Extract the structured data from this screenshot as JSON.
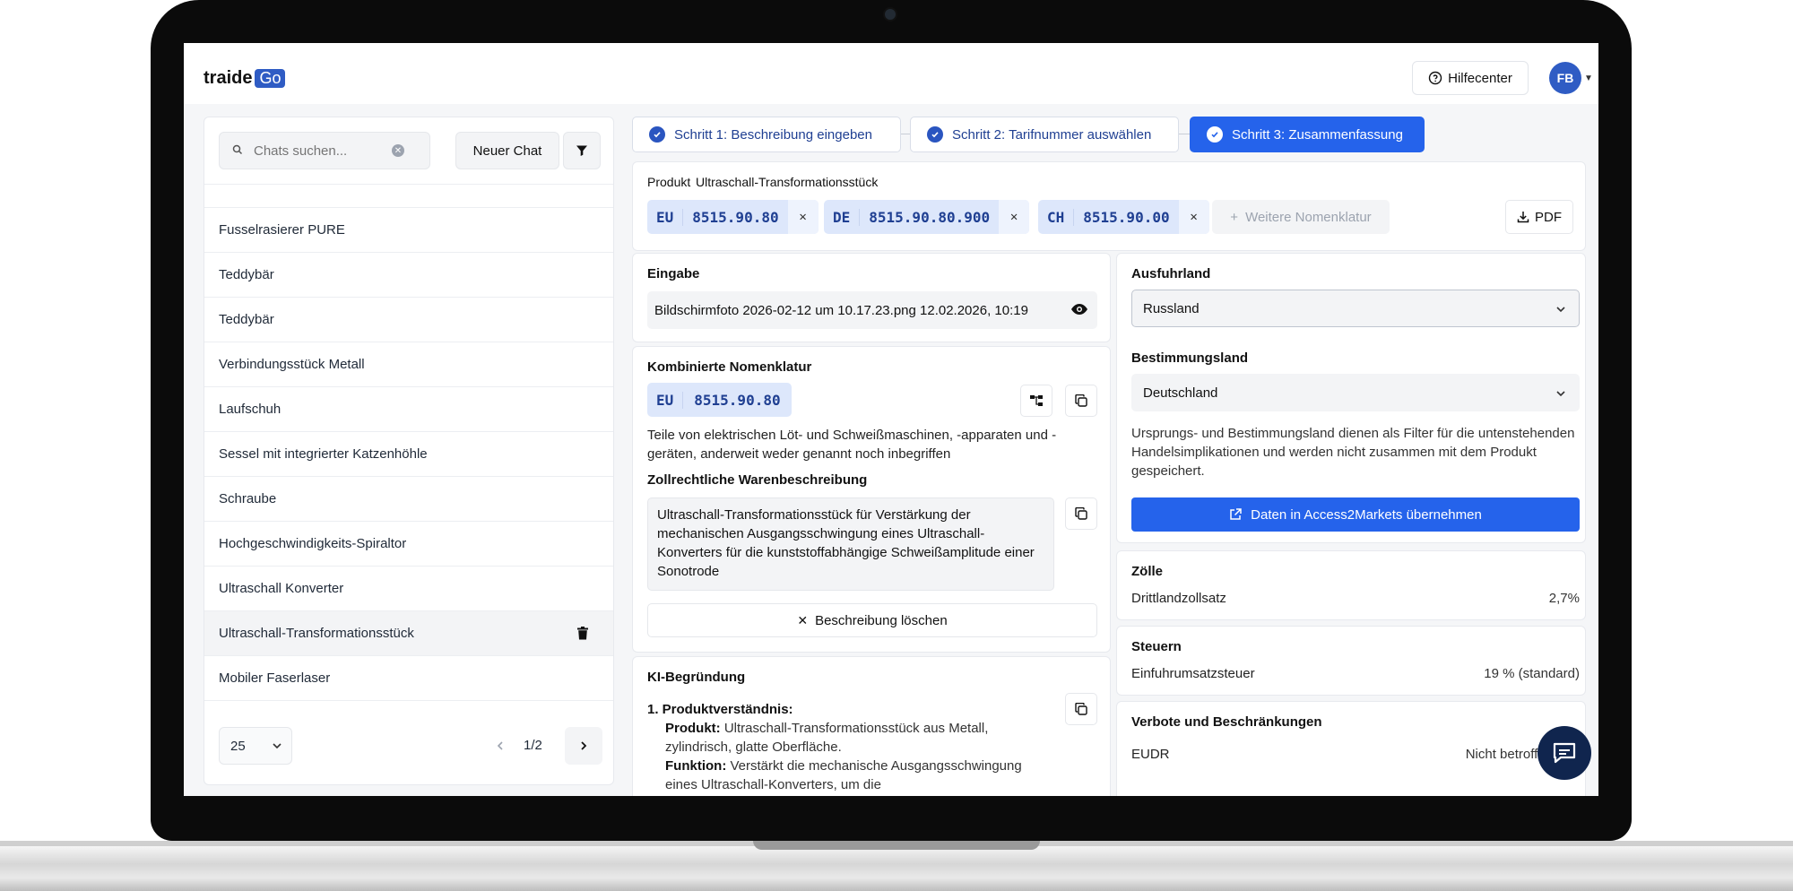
{
  "app": {
    "logo_text": "traide",
    "logo_badge": "Go"
  },
  "header": {
    "help_label": "Hilfecenter",
    "avatar_initials": "FB"
  },
  "sidebar": {
    "search_placeholder": "Chats suchen...",
    "new_chat_label": "Neuer Chat",
    "chats": [
      "Fusselrasierer PURE",
      "Teddybär",
      "Teddybär",
      "Verbindungsstück Metall",
      "Laufschuh",
      "Sessel mit integrierter Katzenhöhle",
      "Schraube",
      "Hochgeschwindigkeits-Spiraltor",
      "Ultraschall Konverter",
      "Ultraschall-Transformationsstück",
      "Mobiler Faserlaser"
    ],
    "page_size": "25",
    "page_indicator": "1/2"
  },
  "steps": [
    {
      "label": "Schritt 1: Beschreibung eingeben"
    },
    {
      "label": "Schritt 2: Tarifnummer auswählen"
    },
    {
      "label": "Schritt 3: Zusammenfassung"
    }
  ],
  "product": {
    "label": "Produkt",
    "name": "Ultraschall-Transformationsstück",
    "nomenclatures": [
      {
        "region": "EU",
        "code": "8515.90.80"
      },
      {
        "region": "DE",
        "code": "8515.90.80.900"
      },
      {
        "region": "CH",
        "code": "8515.90.00"
      }
    ],
    "more_label": "Weitere Nomenklatur",
    "pdf_label": "PDF"
  },
  "eingabe": {
    "title": "Eingabe",
    "file_text": "Bildschirmfoto 2026-02-12 um 10.17.23.png 12.02.2026, 10:19"
  },
  "kombinierte": {
    "title": "Kombinierte Nomenklatur",
    "region": "EU",
    "code": "8515.90.80",
    "description": "Teile von elektrischen Löt- und Schweißmaschinen, -apparaten und -geräten, anderweit weder genannt noch inbegriffen",
    "zoll_title": "Zollrechtliche Warenbeschreibung",
    "zoll_text": "Ultraschall-Transformationsstück für Verstärkung der mechanischen Ausgangsschwingung eines Ultraschall-Konverters für die kunststoffabhängige Schweißamplitude einer Sonotrode",
    "delete_label": "Beschreibung löschen"
  },
  "ki": {
    "title": "KI-Begründung",
    "heading": "1. Produktverständnis:",
    "produkt_label": "Produkt:",
    "produkt_text": "Ultraschall-Transformationsstück aus Metall, zylindrisch, glatte Oberfläche.",
    "funktion_label": "Funktion:",
    "funktion_text": "Verstärkt die mechanische Ausgangsschwingung eines Ultraschall-Konverters, um die"
  },
  "countries": {
    "export_title": "Ausfuhrland",
    "export_value": "Russland",
    "dest_title": "Bestimmungsland",
    "dest_value": "Deutschland",
    "note": "Ursprungs- und Bestimmungsland dienen als Filter für die untenstehenden Handelsimplikationen und werden nicht zusammen mit dem Produkt gespeichert.",
    "a2m_label": "Daten in Access2Markets übernehmen"
  },
  "zoelle": {
    "title": "Zölle",
    "key": "Drittlandzollsatz",
    "value": "2,7%"
  },
  "steuern": {
    "title": "Steuern",
    "key": "Einfuhrumsatzsteuer",
    "value": "19 % (standard)"
  },
  "verbote": {
    "title": "Verbote und Beschränkungen",
    "key": "EUDR",
    "value": "Nicht betroffen"
  }
}
